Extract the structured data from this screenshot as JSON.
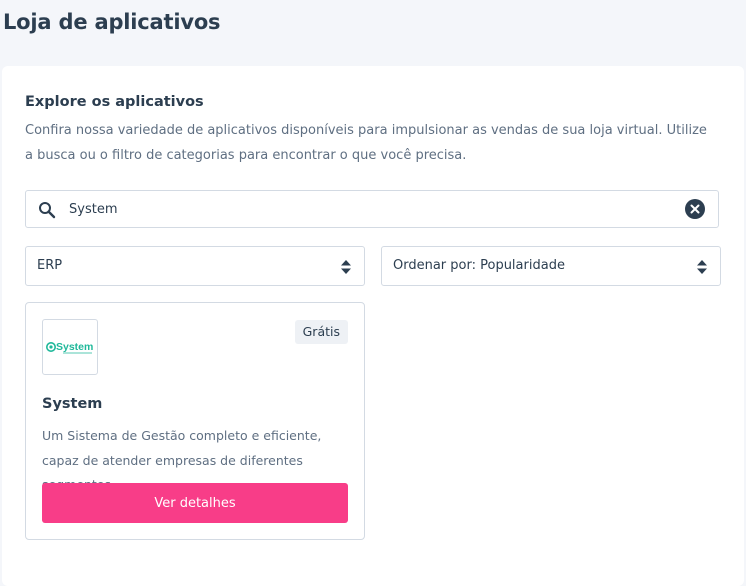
{
  "page": {
    "title": "Loja de aplicativos"
  },
  "explore": {
    "title": "Explore os aplicativos",
    "description": "Confira nossa variedade de aplicativos disponíveis para impulsionar as vendas de sua loja virtual. Utilize a busca ou o filtro de categorias para encontrar o que você precisa."
  },
  "search": {
    "value": "System",
    "search_icon": "search-icon",
    "clear_icon": "close-circle-icon"
  },
  "filters": {
    "category": {
      "value": "ERP",
      "icon": "sort-arrows-icon"
    },
    "sort": {
      "value": "Ordenar por: Popularidade",
      "icon": "sort-arrows-icon"
    }
  },
  "apps": [
    {
      "name": "System",
      "logo_text": "System",
      "price": "Grátis",
      "description": "Um Sistema de Gestão completo e eficiente, capaz de atender empresas de diferentes segmentos",
      "button_label": "Ver detalhes"
    }
  ],
  "colors": {
    "accent": "#f83d88",
    "text": "#2c3e50",
    "muted_text": "#5f6f82",
    "border": "#d3dae3",
    "page_background": "#f4f6fa",
    "logo_green": "#1fb89a"
  }
}
